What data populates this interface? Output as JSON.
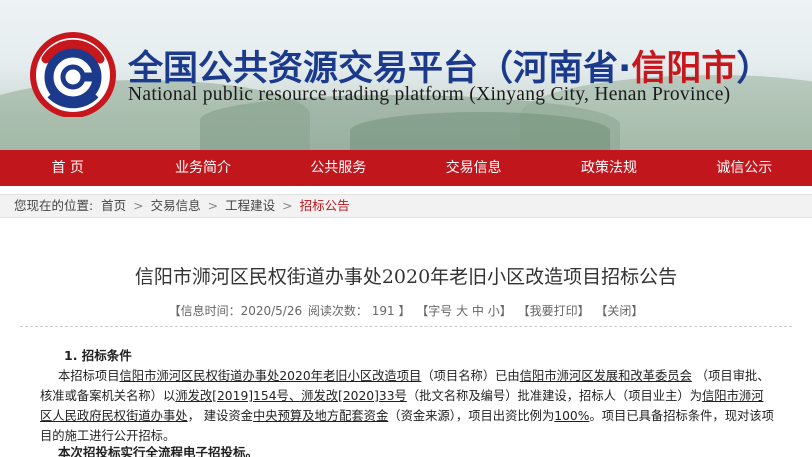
{
  "header": {
    "title_cn": "全国公共资源交易平台",
    "title_region_open": "（河南省·",
    "title_city": "信阳市",
    "title_region_close": "）",
    "title_en": "National public resource trading platform (Xinyang City, Henan Province)",
    "logo_icon": "platform-logo-icon",
    "colors": {
      "brand_blue": "#1c3a8c",
      "brand_red": "#c8161d",
      "nav_red": "#c0161c"
    }
  },
  "nav": {
    "items": [
      "首 页",
      "业务简介",
      "公共服务",
      "交易信息",
      "政策法规",
      "诚信公示"
    ]
  },
  "breadcrumb": {
    "prefix": "您现在的位置:",
    "items": [
      "首页",
      "交易信息",
      "工程建设"
    ],
    "current": "招标公告",
    "separator": ">"
  },
  "article": {
    "title": "信阳市浉河区民权街道办事处2020年老旧小区改造项目招标公告",
    "meta": {
      "info_date": "【信息时间：2020/5/26",
      "views": "阅读次数：  191 】",
      "font_size": "【字号  大  中  小】",
      "print": "【我要打印】",
      "close": "【关闭】"
    },
    "section_heading": "1.   招标条件",
    "para": {
      "p1": "本招标项目",
      "p2": "信阳市浉河区民权街道办事处2020年老旧小区改造项目",
      "p3": "（项目名称）已由",
      "p4": "信阳市浉河区发展和改革委员会",
      "p5": " （项目审批、核准或备案机关名称）以",
      "p6": "浉发改[2019]154号、浉发改[2020]33号",
      "p7": "（批文名称及编号）批准建设，招标人（项目业主）为",
      "p8": "信阳市浉河区人民政府民权街道办事处",
      "p9": "， 建设资金",
      "p10": "中央预算及地方配套资金",
      "p11": "（资金来源），项目出资比例为",
      "p12": "100%",
      "p13": "。项目已具备招标条件，现对该项目的施工进行公开招标。"
    },
    "bold_line": "本次招投标实行全流程电子招投标。"
  }
}
